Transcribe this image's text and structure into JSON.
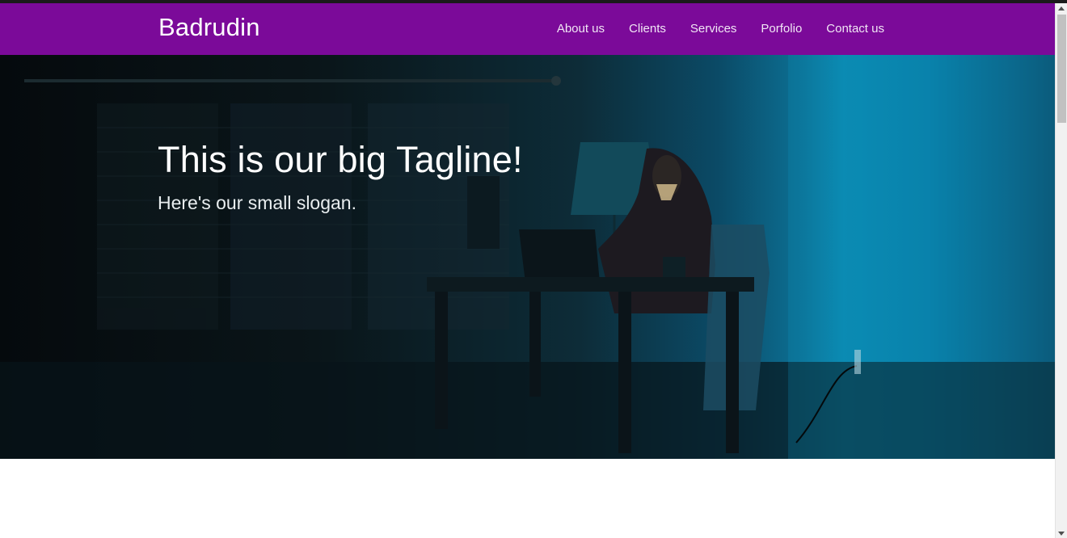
{
  "nav": {
    "brand": "Badrudin",
    "links": [
      "About us",
      "Clients",
      "Services",
      "Porfolio",
      "Contact us"
    ]
  },
  "hero": {
    "tagline": "This is our big Tagline!",
    "slogan": "Here's our small slogan.",
    "image_description_icon": "hacker-at-desk-image"
  },
  "colors": {
    "navbar": "#7b0a99",
    "hero_dark": "#050a0d",
    "hero_cyan": "#0b8ab2"
  }
}
